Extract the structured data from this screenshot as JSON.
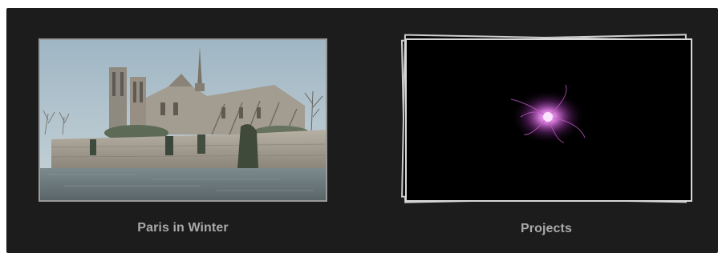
{
  "library": {
    "items": [
      {
        "label": "Paris in Winter",
        "thumbnail_icon": "cathedral-photo-icon"
      },
      {
        "label": "Projects",
        "thumbnail_icon": "particle-nebula-icon"
      }
    ]
  },
  "colors": {
    "background": "#1c1c1c",
    "label_text": "#a9a9a9",
    "frame_border": "#9a9a9a",
    "nebula_accent": "#d26ad6"
  }
}
